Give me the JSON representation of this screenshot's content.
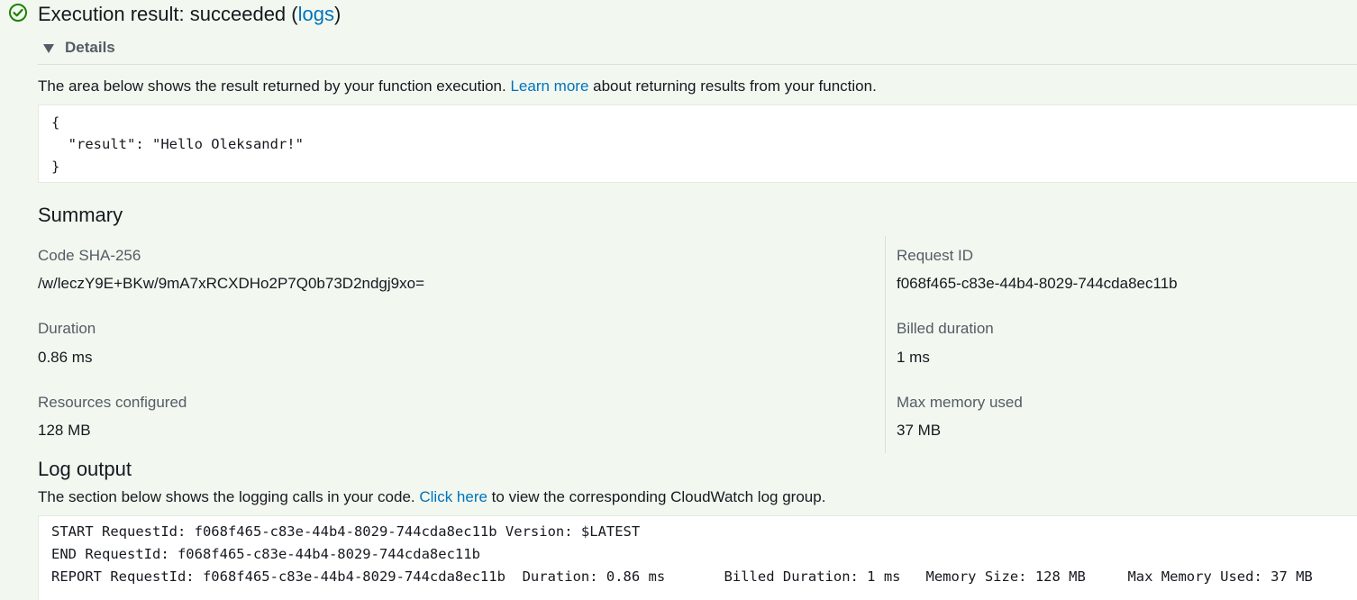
{
  "header": {
    "icon": "check-circle-icon",
    "status_color": "#1d8102",
    "title_prefix": "Execution result: succeeded (",
    "logs_link": "logs",
    "title_suffix": ")"
  },
  "details": {
    "toggle_label": "Details",
    "toggle_icon": "caret-down-icon"
  },
  "result_section": {
    "desc_prefix": "The area below shows the result returned by your function execution. ",
    "learn_more_link": "Learn more",
    "desc_suffix": " about returning results from your function.",
    "code_lines": [
      "{",
      "  \"result\": \"Hello Oleksandr!\"",
      "}"
    ]
  },
  "summary": {
    "heading": "Summary",
    "code_sha_label": "Code SHA-256",
    "code_sha_value": "/w/leczY9E+BKw/9mA7xRCXDHo2P7Q0b73D2ndgj9xo=",
    "request_id_label": "Request ID",
    "request_id_value": "f068f465-c83e-44b4-8029-744cda8ec11b",
    "duration_label": "Duration",
    "duration_value": "0.86 ms",
    "billed_duration_label": "Billed duration",
    "billed_duration_value": "1 ms",
    "resources_label": "Resources configured",
    "resources_value": "128 MB",
    "max_memory_label": "Max memory used",
    "max_memory_value": "37 MB"
  },
  "log_output": {
    "heading": "Log output",
    "desc_prefix": "The section below shows the logging calls in your code. ",
    "click_here_link": "Click here",
    "desc_suffix": " to view the corresponding CloudWatch log group.",
    "log_lines": [
      "START RequestId: f068f465-c83e-44b4-8029-744cda8ec11b Version: $LATEST",
      "END RequestId: f068f465-c83e-44b4-8029-744cda8ec11b",
      "REPORT RequestId: f068f465-c83e-44b4-8029-744cda8ec11b  Duration: 0.86 ms       Billed Duration: 1 ms   Memory Size: 128 MB     Max Memory Used: 37 MB"
    ]
  },
  "colors": {
    "background": "#f2f8f0",
    "link": "#0073bb",
    "text": "#16191f",
    "label": "#545b64"
  }
}
